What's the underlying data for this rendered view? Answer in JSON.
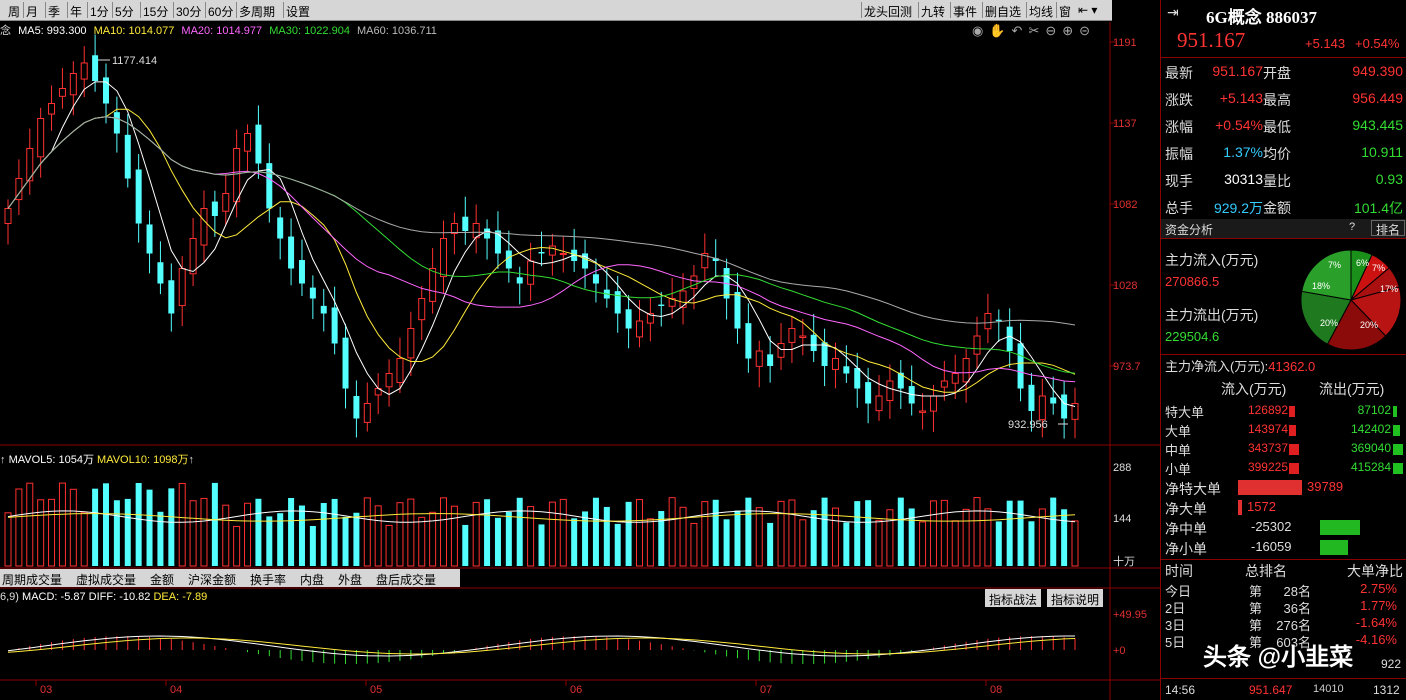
{
  "toolbar": {
    "left": [
      "周",
      "月",
      "季",
      "年",
      "1分",
      "5分",
      "15分",
      "30分",
      "60分",
      "多周期",
      "设置"
    ],
    "right": [
      "龙头回测",
      "九转",
      "事件",
      "删自选",
      "均线",
      "窗"
    ]
  },
  "ma_bar": {
    "prefix": "念",
    "ma5": "MA5: 993.300",
    "ma10": "MA10: 1014.077",
    "ma20": "MA20: 1014.977",
    "ma30": "MA30: 1022.904",
    "ma60": "MA60: 1036.711"
  },
  "price_axis": [
    "1191",
    "1137",
    "1082",
    "1028",
    "973.7"
  ],
  "labels": {
    "high": "1177.414",
    "low": "932.956"
  },
  "vol_bar": {
    "a": "MAVOL5: 1054万",
    "b": "MAVOL10: 1098万"
  },
  "vol_axis": [
    "288",
    "144",
    "十万"
  ],
  "vol_tabs": [
    "周期成交量",
    "虚拟成交量",
    "金额",
    "沪深金额",
    "换手率",
    "内盘",
    "外盘",
    "盘后成交量"
  ],
  "macd_bar": {
    "p": "6,9)",
    "macd": "MACD: -5.87",
    "diff": "DIFF: -10.82",
    "dea": "DEA: -7.89"
  },
  "macd_tabs": [
    "指标战法",
    "指标说明"
  ],
  "macd_axis": [
    "+49.95",
    "+0"
  ],
  "months": [
    "03",
    "04",
    "05",
    "06",
    "07",
    "08"
  ],
  "header": {
    "title": "6G概念 886037",
    "price": "951.167",
    "chg": "+5.143",
    "pct": "+0.54%"
  },
  "quote": [
    {
      "l": "最新",
      "v": "951.167",
      "l2": "开盘",
      "v2": "949.390",
      "c2": "red"
    },
    {
      "l": "涨跌",
      "v": "+5.143",
      "l2": "最高",
      "v2": "956.449",
      "c2": "red"
    },
    {
      "l": "涨幅",
      "v": "+0.54%",
      "l2": "最低",
      "v2": "943.445",
      "c2": "green"
    },
    {
      "l": "振幅",
      "v": "1.37%",
      "l2": "均价",
      "v2": "10.911",
      "c2": "green",
      "c1": "cyan"
    },
    {
      "l": "现手",
      "v": "30313",
      "l2": "量比",
      "v2": "0.93",
      "c2": "green",
      "c1": "white"
    },
    {
      "l": "总手",
      "v": "929.2万",
      "l2": "金额",
      "v2": "101.4亿",
      "c2": "green",
      "c1": "cyan"
    }
  ],
  "fund": {
    "title": "资金分析",
    "rank": "排名",
    "q": "?",
    "in_label": "主力流入(万元)",
    "in_val": "270866.5",
    "out_label": "主力流出(万元)",
    "out_val": "229504.6",
    "net_label": "主力净流入(万元):",
    "net_val": "41362.0",
    "pie": [
      "7%",
      "6%",
      "7%",
      "17%",
      "18%",
      "20%",
      "20%"
    ]
  },
  "flow": {
    "h_in": "流入(万元)",
    "h_out": "流出(万元)",
    "rows": [
      {
        "l": "特大单",
        "in": "126892",
        "out": "87102",
        "inw": 0.6,
        "outw": 0.4
      },
      {
        "l": "大单",
        "in": "143974",
        "out": "142402",
        "inw": 0.7,
        "outw": 0.7
      },
      {
        "l": "中单",
        "in": "343737",
        "out": "369040",
        "inw": 1,
        "outw": 1
      },
      {
        "l": "小单",
        "in": "399225",
        "out": "415284",
        "inw": 1,
        "outw": 1
      }
    ]
  },
  "net": [
    {
      "l": "净特大单",
      "v": "39789",
      "w": 0.8,
      "c": "red"
    },
    {
      "l": "净大单",
      "v": "1572",
      "w": 0.05,
      "c": "red"
    },
    {
      "l": "净中单",
      "v": "-25302",
      "w": 0.5,
      "c": "green"
    },
    {
      "l": "净小单",
      "v": "-16059",
      "w": 0.35,
      "c": "green"
    }
  ],
  "rank": {
    "h": [
      "时间",
      "总排名",
      "大单净比"
    ],
    "rows": [
      {
        "t": "今日",
        "a": "第",
        "n": "28名",
        "p": "2.75%"
      },
      {
        "t": "2日",
        "a": "第",
        "n": "36名",
        "p": "1.77%"
      },
      {
        "t": "3日",
        "a": "第",
        "n": "276名",
        "p": "-1.64%"
      },
      {
        "t": "5日",
        "a": "第",
        "n": "603名",
        "p": "-4.16%"
      }
    ]
  },
  "bottom": {
    "time": "14:56",
    "price": "951.647",
    "vol": "14010",
    "last": "1312",
    "partial": "922"
  },
  "watermark": "头条 @小韭菜"
}
